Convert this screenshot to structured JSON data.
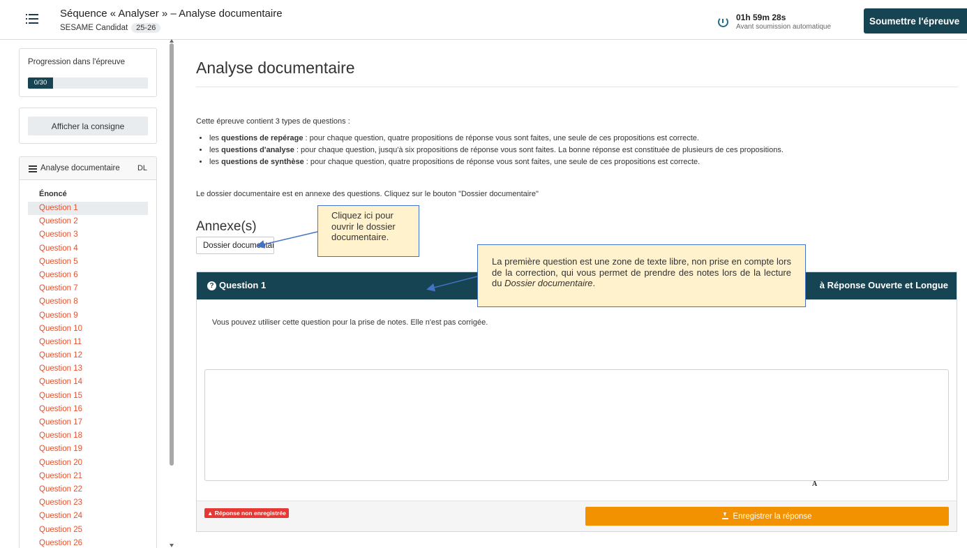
{
  "header": {
    "title": "Séquence « Analyser » – Analyse documentaire",
    "subtitle": "SESAME Candidat",
    "year_badge": "25-26",
    "timer_value": "01h 59m 28s",
    "timer_label": "Avant soumission automatique",
    "submit_label": "Soumettre l'épreuve"
  },
  "sidebar": {
    "progress_label": "Progression dans l'épreuve",
    "progress_text": "0/30",
    "progress_fraction": 0.0,
    "consigne_label": "Afficher la consigne",
    "nav_title": "Analyse documentaire",
    "nav_badge": "DL",
    "enonce_label": "Énoncé",
    "questions": [
      "Question 1",
      "Question 2",
      "Question 3",
      "Question 4",
      "Question 5",
      "Question 6",
      "Question 7",
      "Question 8",
      "Question 9",
      "Question 10",
      "Question 11",
      "Question 12",
      "Question 13",
      "Question 14",
      "Question 15",
      "Question 16",
      "Question 17",
      "Question 18",
      "Question 19",
      "Question 20",
      "Question 21",
      "Question 22",
      "Question 23",
      "Question 24",
      "Question 25",
      "Question 26"
    ]
  },
  "main": {
    "title": "Analyse documentaire",
    "intro": "Cette épreuve contient 3 types de questions :",
    "bullets": [
      {
        "prefix": "les ",
        "bold": "questions de repérage",
        "text": " : pour chaque question, quatre propositions de réponse vous sont faites, une seule de ces propositions est correcte."
      },
      {
        "prefix": "les ",
        "bold": "questions d'analyse",
        "text": " : pour chaque question, jusqu'à six propositions de réponse vous sont faites. La bonne réponse est constituée de plusieurs de ces propositions."
      },
      {
        "prefix": "les ",
        "bold": "questions de synthèse",
        "text": " : pour chaque question, quatre propositions de réponse vous sont faites, une seule de ces propositions est correcte."
      }
    ],
    "dossier_note": "Le dossier documentaire est en annexe des questions. Cliquez sur le bouton \"Dossier documentaire\"",
    "annexe_title": "Annexe(s)",
    "dossier_button": "Dossier documentaire"
  },
  "question": {
    "title": "Question 1",
    "type_label": "à Réponse Ouverte et Longue",
    "text": "Vous pouvez utiliser cette question pour la prise de notes. Elle n'est pas corrigée.",
    "answer_value": "",
    "font_icon_glyph": "A",
    "status_badge": "Réponse non enregistrée",
    "save_label": "Enregistrer la réponse"
  },
  "tooltips": {
    "dossier_tip": "Cliquez ici pour ouvrir le dossier documentaire.",
    "question_tip_main": "La première question est une zone de texte libre, non prise en compte lors de la correction, qui vous permet de prendre des notes lors de la lecture du ",
    "question_tip_italic": "Dossier documentaire",
    "question_tip_end": "."
  },
  "colors": {
    "header_dark": "#174452",
    "question_link": "#e3522f",
    "save_orange": "#f39200",
    "status_red": "#e53935",
    "tooltip_bg": "#fff2cc",
    "tooltip_border": "#4472c4"
  }
}
